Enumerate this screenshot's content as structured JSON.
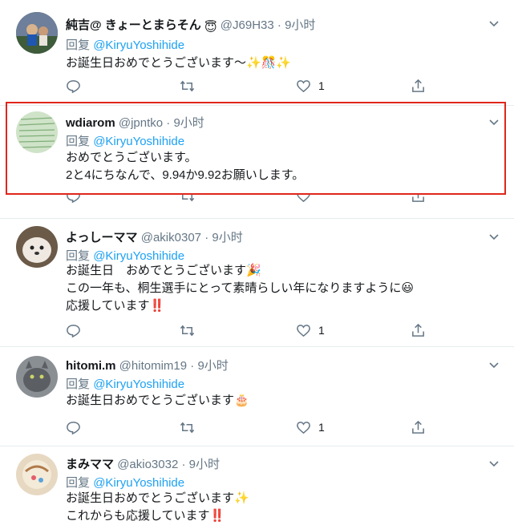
{
  "tweets": [
    {
      "name": "純吉@ きょーとまらそん",
      "name_emoji": "😇",
      "handle": "@J69H33",
      "sep": "·",
      "time": "9小时",
      "reply_prefix": "回复",
      "reply_to": "@KiryuYoshihide",
      "lines": [
        "お誕生日おめでとうございます～✨🎊✨"
      ],
      "reply_count": "",
      "retweet_count": "",
      "like_count": "1"
    },
    {
      "name": "wdiarom",
      "handle": "@jpntko",
      "sep": "·",
      "time": "9小时",
      "reply_prefix": "回复",
      "reply_to": "@KiryuYoshihide",
      "lines": [
        "おめでとうございます。",
        "2と4にちなんで、9.94か9.92お願いします。"
      ],
      "reply_count": "",
      "retweet_count": "",
      "like_count": ""
    },
    {
      "name": "よっしーママ",
      "handle": "@akik0307",
      "sep": "·",
      "time": "9小时",
      "reply_prefix": "回复",
      "reply_to": "@KiryuYoshihide",
      "lines": [
        "お誕生日　おめでとうございます🎉",
        "この一年も、桐生選手にとって素晴らしい年になりますように😃",
        "応援しています‼️"
      ],
      "reply_count": "",
      "retweet_count": "",
      "like_count": "1"
    },
    {
      "name": "hitomi.m",
      "handle": "@hitomim19",
      "sep": "·",
      "time": "9小时",
      "reply_prefix": "回复",
      "reply_to": "@KiryuYoshihide",
      "lines": [
        "お誕生日おめでとうございます🎂"
      ],
      "reply_count": "",
      "retweet_count": "",
      "like_count": "1"
    },
    {
      "name": "まみママ",
      "handle": "@akio3032",
      "sep": "·",
      "time": "9小时",
      "reply_prefix": "回复",
      "reply_to": "@KiryuYoshihide",
      "lines": [
        "お誕生日おめでとうございます✨",
        "これからも応援しています‼️"
      ],
      "reply_count": "",
      "retweet_count": "",
      "like_count": ""
    }
  ],
  "icons": {
    "reply": "reply-icon",
    "retweet": "retweet-icon",
    "like": "heart-icon",
    "share": "share-icon",
    "menu": "chevron-down-icon"
  },
  "colors": {
    "link": "#1da1f2",
    "muted": "#657786",
    "highlight_border": "#e0261b"
  }
}
